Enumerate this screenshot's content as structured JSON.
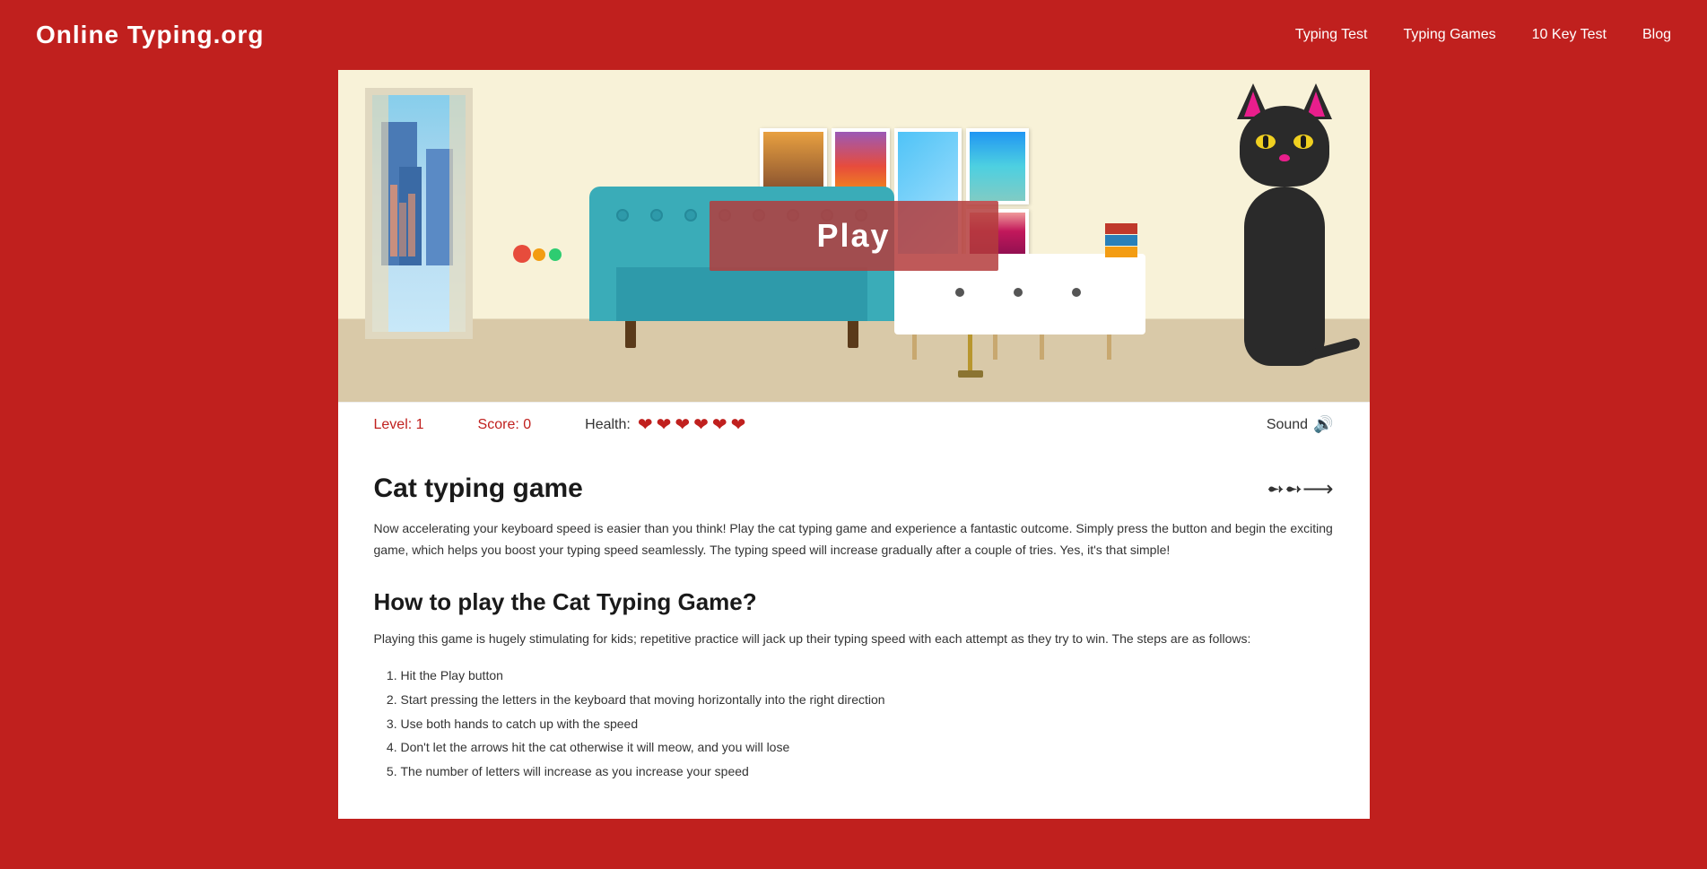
{
  "header": {
    "logo": "Online Typing.org",
    "nav": [
      {
        "label": "Typing Test",
        "href": "#"
      },
      {
        "label": "Typing Games",
        "href": "#"
      },
      {
        "label": "10 Key Test",
        "href": "#"
      },
      {
        "label": "Blog",
        "href": "#"
      }
    ]
  },
  "game": {
    "play_button": "Play",
    "level_label": "Level: 1",
    "score_label": "Score: 0",
    "health_label": "Health:",
    "hearts_count": 6,
    "sound_label": "Sound"
  },
  "content": {
    "title": "Cat typing game",
    "description": "Now accelerating your keyboard speed is easier than you think! Play the cat typing game and experience a fantastic outcome. Simply press the button and begin the exciting game, which helps you boost your typing speed seamlessly. The typing speed will increase gradually after a couple of tries. Yes, it's that simple!",
    "how_to_title": "How to play the Cat Typing Game?",
    "how_to_intro": "Playing this game is hugely stimulating for kids; repetitive practice will jack up their typing speed with each attempt as they try to win. The steps are as follows:",
    "instructions": [
      "Hit the Play button",
      "Start pressing the letters in the keyboard that moving horizontally into the right direction",
      "Use both hands to catch up with the speed",
      "Don't let the arrows hit the cat otherwise it will meow, and you will lose",
      "The number of letters will increase as you increase your speed"
    ]
  }
}
